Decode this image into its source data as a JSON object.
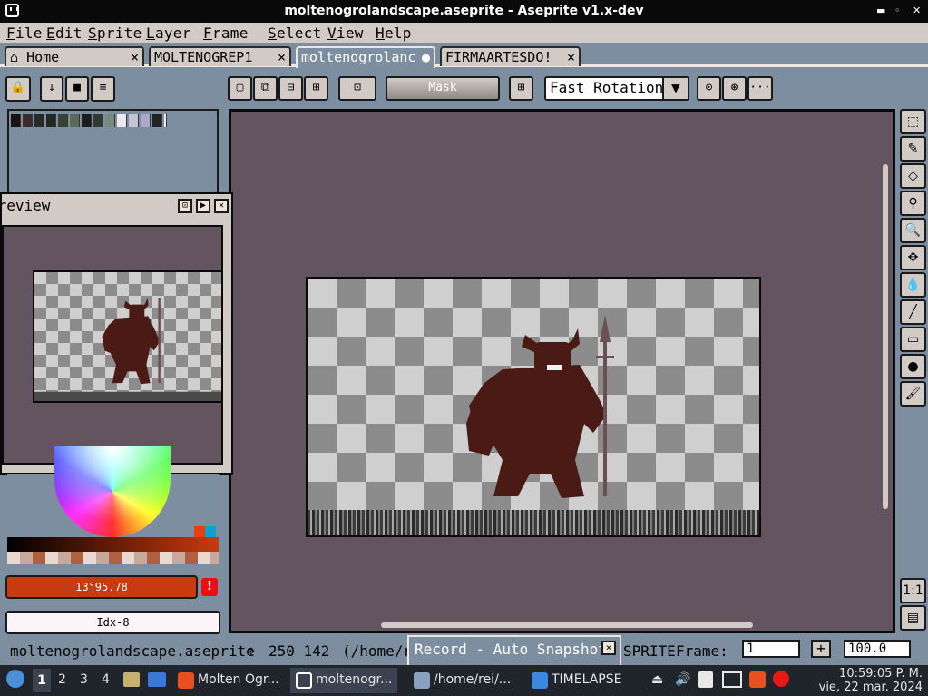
{
  "window": {
    "title": "moltenogrolandscape.aseprite - Aseprite v1.x-dev"
  },
  "menu": [
    "File",
    "Edit",
    "Sprite",
    "Layer",
    "Frame",
    "Select",
    "View",
    "Help"
  ],
  "tabs": [
    {
      "label": "Home",
      "close": "×"
    },
    {
      "label": "MOLTENOGREP1",
      "close": "×"
    },
    {
      "label": "moltenogrolanc",
      "close": "●"
    },
    {
      "label": "FIRMAARTESDO!",
      "close": "×"
    }
  ],
  "toolbar": {
    "mask_label": "Mask",
    "rotation_select": "Fast Rotation",
    "more_label": "···"
  },
  "palette": {
    "colors": [
      "#1a1414",
      "#3a2a2a",
      "#2a2a24",
      "#1e2a22",
      "#384234",
      "#5a6a58",
      "#1c1c1c",
      "#2f3a30",
      "#7a8a7a",
      "#efe8f0",
      "#c7c2d4",
      "#aaa8c8",
      "#222222"
    ]
  },
  "preview": {
    "title": "Preview"
  },
  "color": {
    "hsv_value": "13°95.78",
    "warning": "!",
    "index_value": "Idx-8",
    "accent": "#c83a10"
  },
  "status": {
    "filename": "moltenogrolandscape.aseprite",
    "coords": "250 142",
    "path": "(/home/r",
    "sprite_suffix": "SPRITE",
    "frame_label": "Frame:",
    "frame_value": "1",
    "zoom_value": "100.0"
  },
  "record": {
    "title": "Record - Auto Snapshot",
    "close": "×"
  },
  "taskbar": {
    "workspaces": [
      "1",
      "2",
      "3",
      "4"
    ],
    "windows": [
      {
        "label": "Molten Ogr..."
      },
      {
        "label": "moltenogr..."
      },
      {
        "label": "/home/rei/..."
      },
      {
        "label": "TIMELAPSE"
      }
    ],
    "time": "10:59:05 P. M.",
    "date": "vie, 22 mar. 2024"
  }
}
